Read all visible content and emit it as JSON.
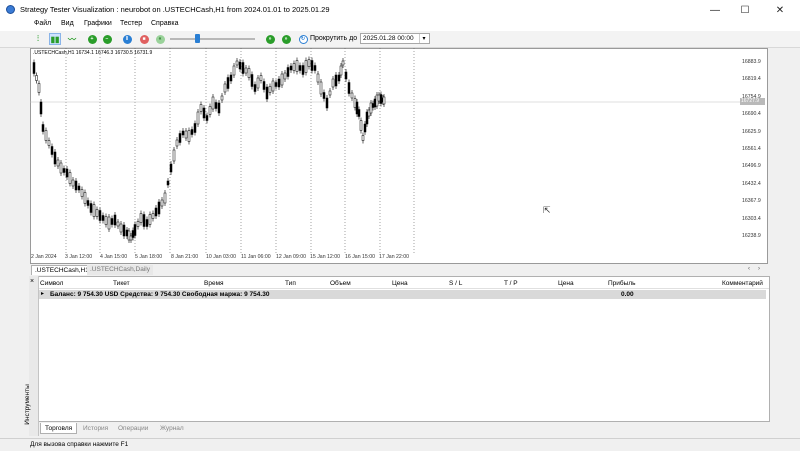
{
  "window": {
    "title": "Strategy Tester Visualization : neurobot on .USTECHCash,H1 from 2024.01.01 to 2025.01.29",
    "minimize": "—",
    "maximize": "☐",
    "close": "✕"
  },
  "menu": [
    "Файл",
    "Вид",
    "Графики",
    "Тестер",
    "Справка"
  ],
  "toolbar": {
    "goto_label": "Прокрутить до",
    "goto_date": "2025.01.28 00:00",
    "speed_fraction": 0.3
  },
  "chart": {
    "info": ".USTECHCash,H1  16734.1  16746.3  16730.5  16731.9",
    "price_tag": "16727.9",
    "y_ticks": [
      "16883.9",
      "16819.4",
      "16754.9",
      "16690.4",
      "16625.9",
      "16561.4",
      "16496.9",
      "16432.4",
      "16367.9",
      "16303.4",
      "16238.9"
    ],
    "x_ticks": [
      "2 Jan 2024",
      "3 Jan 12:00",
      "4 Jan 15:00",
      "5 Jan 18:00",
      "8 Jan 21:00",
      "10 Jan 03:00",
      "11 Jan 06:00",
      "12 Jan 09:00",
      "15 Jan 12:00",
      "16 Jan 15:00",
      "17 Jan 22:00"
    ],
    "colors": {
      "up": "#000000",
      "down": "#000000",
      "grid": "#000000",
      "bid_line": "#c0c0c0"
    }
  },
  "chart_tabs": [
    ".USTECHCash,H1",
    ".USTECHCash,Daily"
  ],
  "table": {
    "headers": [
      "Символ",
      "Тикет",
      "Время",
      "Тип",
      "Объем",
      "Цена",
      "S / L",
      "T / P",
      "Цена",
      "Прибыль",
      "Комментарий"
    ],
    "balance_text": "Баланс: 9 754.30 USD  Средства: 9 754.30  Свободная маржа: 9 754.30",
    "balance_profit": "0.00"
  },
  "toolbox": {
    "label": "Инструменты",
    "close": "×"
  },
  "bottom_tabs": [
    "Торговля",
    "История",
    "Операции",
    "Журнал"
  ],
  "status": "Для вызова справки нажмите F1"
}
